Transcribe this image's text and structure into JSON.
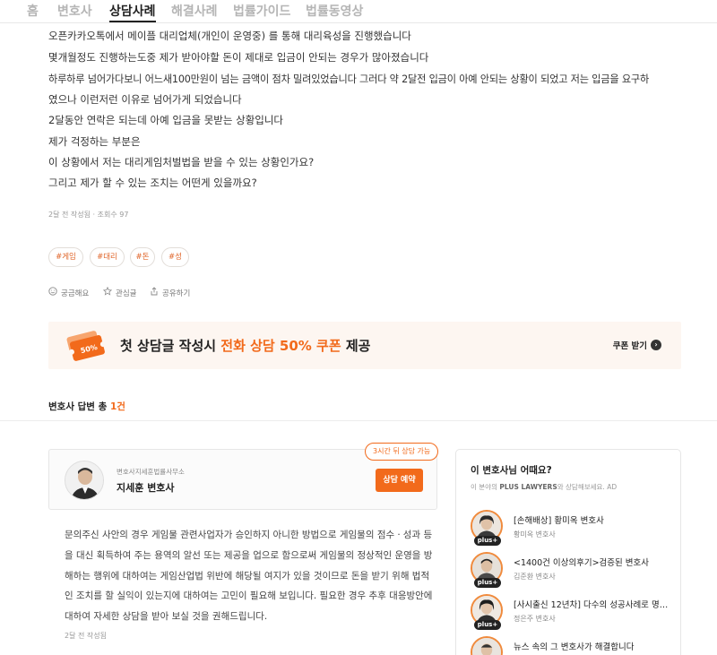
{
  "nav": {
    "items": [
      "홈",
      "변호사",
      "상담사례",
      "해결사례",
      "법률가이드",
      "법률동영상"
    ]
  },
  "question": {
    "lines": [
      "오픈카카오톡에서 메이플 대리업체(개인이 운영중) 를 통해 대리육성을 진행했습니다",
      "몇개월정도 진행하는도중 제가 받아야할 돈이 제대로 입금이 안되는 경우가 많아졌습니다",
      "하루하루 넘어가다보니 어느새100만원이 넘는 금액이 점차 밀려있었습니다 그러다 약 2달전 입금이 아예 안되는 상황이 되었고 저는 입금을 요구하",
      "였으나 이런저런 이유로 넘어가게 되었습니다",
      "2달동안 연락은 되는데 아예 입금을 못받는 상황입니다",
      "제가 걱정하는 부분은",
      "이 상황에서 저는 대리게임처벌법을 받을 수 있는 상황인가요?",
      "그리고 제가 할 수 있는 조치는 어떤게 있을까요?"
    ],
    "meta": "2달 전 작성됨 · 조회수 97",
    "tags": [
      "#게임",
      "#대리",
      "#돈",
      "#성"
    ],
    "actions": {
      "curious": "궁금해요",
      "bookmark": "관심글",
      "share": "공유하기"
    }
  },
  "banner": {
    "text_prefix": "첫 상담글 작성시 ",
    "text_highlight": "전화 상담 50% 쿠폰",
    "text_suffix": " 제공",
    "coupon_label": "50%",
    "cta": "쿠폰 받기"
  },
  "answers": {
    "heading_prefix": "변호사 답변 총 ",
    "count": "1건"
  },
  "lawyer": {
    "firm": "변호사지세훈법률사무소",
    "name": "지세훈 변호사",
    "availability": "3시간 뒤 상담 가능",
    "book_label": "상담 예약"
  },
  "answer": {
    "lines": [
      "문의주신 사안의 경우 게임물 관련사업자가 승인하지 아니한 방법으로 게임물의 점수ㆍ성과 등",
      "을 대신 획득하여 주는 용역의 알선 또는 제공을 업으로 함으로써 게임물의 정상적인 운영을 방",
      "해하는 행위에 대하여는 게임산업법 위반에 해당될 여지가 있을 것이므로 돈을 받기 위해 법적",
      "인 조치를 할 실익이 있는지에 대하여는 고민이 필요해 보입니다. 필요한 경우 추후 대응방안에",
      "대하여 자세한 상담을 받아 보실 것을 권해드립니다."
    ],
    "meta": "2달 전 작성됨"
  },
  "recommend": {
    "title": "이 변호사님 어때요?",
    "sub_prefix": "이 분야의 ",
    "sub_brand": "PLUS LAWYERS",
    "sub_suffix": "와 상담해보세요.  AD",
    "badge": "plus+",
    "items": [
      {
        "headline": "[손해배상] 황미옥 변호사",
        "name": "황미옥 변호사"
      },
      {
        "headline": "<1400건 이상의후기>검증된 변호사",
        "name": "김준환 변호사"
      },
      {
        "headline": "[사시출신 12년차] 다수의 성공사례로 명쾌...",
        "name": "정은주 변호사"
      },
      {
        "headline": "뉴스 속의 그 변호사가 해결합니다",
        "name": ""
      }
    ]
  },
  "colors": {
    "accent": "#f26a1b",
    "banner_bg": "#fdf6f1"
  }
}
